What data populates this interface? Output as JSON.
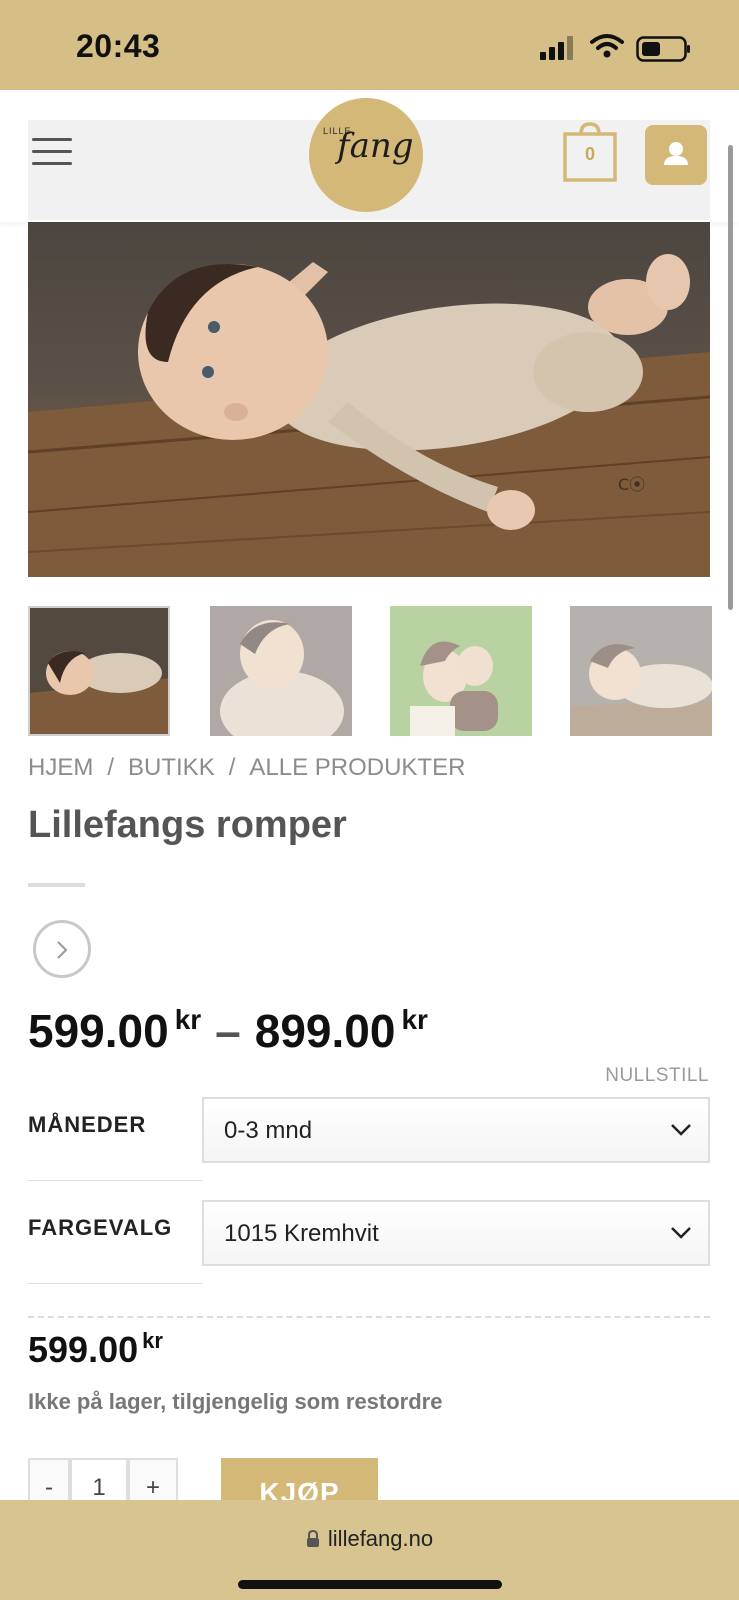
{
  "status_bar": {
    "time": "20:43"
  },
  "header": {
    "logo_small": "LILLE",
    "logo_script": "fang",
    "cart_count": "0"
  },
  "breadcrumb": {
    "home": "HJEM",
    "shop": "BUTIKK",
    "category": "ALLE PRODUKTER",
    "separator": "/"
  },
  "product": {
    "title": "Lillefangs romper",
    "price_min": "599.00",
    "price_max": "899.00",
    "currency": "kr",
    "range_dash": "–",
    "reset_label": "NULLSTILL",
    "variations": [
      {
        "label": "MÅNEDER",
        "value": "0-3 mnd"
      },
      {
        "label": "FARGEVALG",
        "value": "1015 Kremhvit"
      }
    ],
    "variant_price": "599.00",
    "stock_note": "Ikke på lager, tilgjengelig som restordre",
    "qty_minus": "-",
    "qty_value": "1",
    "qty_plus": "+",
    "buy_label": "KJØP"
  },
  "browser": {
    "url": "lillefang.no"
  },
  "colors": {
    "brand_gold": "#d4b877",
    "status_bar": "#d6bf86",
    "browser_bar": "#d8c490"
  }
}
